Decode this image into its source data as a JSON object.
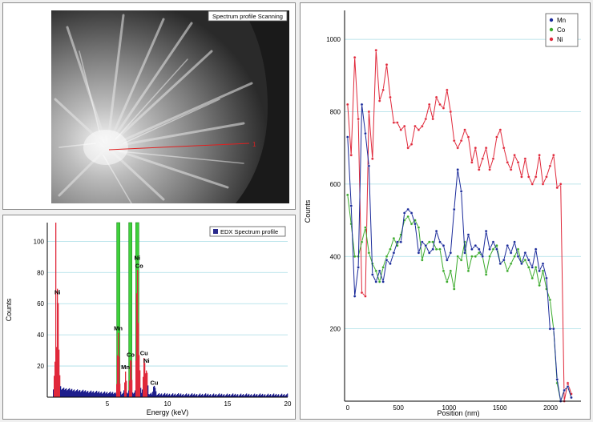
{
  "sem": {
    "legend": "Spectrum profile Scanning",
    "marker_label": "1"
  },
  "colors": {
    "axis_bg": "#ffffff",
    "grid": "#a8dde6",
    "mn": "#1a2a9a",
    "co": "#3aaa2a",
    "ni": "#e0283a",
    "edx_fill": "#1e1e8c",
    "edx_legend": "#2a2a8c"
  },
  "chart_data": [
    {
      "type": "bar",
      "title": "",
      "xlabel": "Energy (keV)",
      "ylabel": "Counts",
      "xlim": [
        0,
        20
      ],
      "ylim": [
        0,
        112
      ],
      "x_ticks": [
        5,
        10,
        15,
        20
      ],
      "y_ticks": [
        20,
        40,
        60,
        80,
        100
      ],
      "legend": {
        "position": "top-right",
        "entries": [
          "EDX Spectrum profile"
        ]
      },
      "peak_labels": [
        {
          "text": "Ni",
          "x": 0.85,
          "y": 66,
          "color": "#e0283a"
        },
        {
          "text": "Mn",
          "x": 5.9,
          "y": 43,
          "color": "#e0283a"
        },
        {
          "text": "Mn",
          "x": 6.5,
          "y": 18,
          "color": "#e0283a"
        },
        {
          "text": "Co",
          "x": 6.93,
          "y": 26,
          "color": "#e0283a"
        },
        {
          "text": "Ni",
          "x": 7.48,
          "y": 88,
          "color": "#3aaa2a"
        },
        {
          "text": "Co",
          "x": 7.65,
          "y": 83,
          "color": "#e0283a"
        },
        {
          "text": "Cu",
          "x": 8.05,
          "y": 27,
          "color": "#e0283a"
        },
        {
          "text": "Ni",
          "x": 8.26,
          "y": 22,
          "color": "#e0283a"
        },
        {
          "text": "Cu",
          "x": 8.9,
          "y": 8,
          "color": "#e0283a"
        }
      ],
      "window_bars": [
        {
          "x": 5.9,
          "width": 0.25,
          "value": 112
        },
        {
          "x": 6.9,
          "width": 0.25,
          "value": 112
        },
        {
          "x": 7.48,
          "width": 0.25,
          "value": 112
        }
      ],
      "peaks": [
        {
          "center": 0.6,
          "height": 8,
          "width": 0.1
        },
        {
          "center": 0.85,
          "height": 63,
          "width": 0.05
        },
        {
          "center": 0.7,
          "height": 102,
          "width": 0.03
        },
        {
          "center": 0.95,
          "height": 22,
          "width": 0.06
        },
        {
          "center": 5.9,
          "height": 38,
          "width": 0.07
        },
        {
          "center": 6.5,
          "height": 14,
          "width": 0.06
        },
        {
          "center": 6.93,
          "height": 24,
          "width": 0.07
        },
        {
          "center": 7.48,
          "height": 80,
          "width": 0.07
        },
        {
          "center": 7.65,
          "height": 18,
          "width": 0.07
        },
        {
          "center": 8.05,
          "height": 24,
          "width": 0.07
        },
        {
          "center": 8.26,
          "height": 16,
          "width": 0.07
        },
        {
          "center": 8.9,
          "height": 6,
          "width": 0.08
        }
      ]
    },
    {
      "type": "line",
      "title": "",
      "xlabel": "Position (nm)",
      "ylabel": "Counts",
      "xlim": [
        -30,
        2300
      ],
      "ylim": [
        0,
        1080
      ],
      "x_ticks": [
        0,
        500,
        1000,
        1500,
        2000
      ],
      "y_ticks": [
        200,
        400,
        600,
        800,
        1000
      ],
      "legend": {
        "position": "top-right"
      },
      "x": [
        0,
        35,
        70,
        105,
        140,
        175,
        210,
        245,
        280,
        315,
        350,
        385,
        420,
        455,
        490,
        525,
        560,
        595,
        630,
        665,
        700,
        735,
        770,
        805,
        840,
        875,
        910,
        945,
        980,
        1015,
        1050,
        1085,
        1120,
        1155,
        1190,
        1225,
        1260,
        1295,
        1330,
        1365,
        1400,
        1435,
        1470,
        1505,
        1540,
        1575,
        1610,
        1645,
        1680,
        1715,
        1750,
        1785,
        1820,
        1855,
        1890,
        1925,
        1960,
        1995,
        2030,
        2065,
        2100,
        2135,
        2170,
        2205
      ],
      "series": [
        {
          "name": "Mn",
          "color": "#1a2a9a",
          "values": [
            730,
            540,
            290,
            370,
            820,
            740,
            650,
            350,
            330,
            360,
            330,
            390,
            380,
            410,
            440,
            440,
            520,
            530,
            520,
            490,
            410,
            440,
            430,
            410,
            420,
            470,
            440,
            430,
            390,
            410,
            530,
            640,
            580,
            410,
            460,
            420,
            430,
            420,
            400,
            470,
            420,
            440,
            420,
            380,
            390,
            430,
            410,
            440,
            400,
            380,
            410,
            390,
            370,
            420,
            360,
            380,
            340,
            200,
            200,
            60,
            0,
            30,
            40,
            10
          ]
        },
        {
          "name": "Co",
          "color": "#3aaa2a",
          "values": [
            570,
            490,
            400,
            400,
            440,
            480,
            410,
            380,
            360,
            330,
            370,
            400,
            420,
            450,
            430,
            460,
            500,
            510,
            490,
            500,
            480,
            390,
            430,
            440,
            440,
            420,
            420,
            360,
            330,
            360,
            310,
            400,
            390,
            440,
            360,
            400,
            400,
            410,
            400,
            350,
            400,
            420,
            430,
            380,
            390,
            360,
            380,
            400,
            420,
            380,
            390,
            370,
            340,
            370,
            320,
            360,
            310,
            280,
            200,
            50,
            0,
            30,
            40,
            10
          ]
        },
        {
          "name": "Ni",
          "color": "#e0283a",
          "values": [
            820,
            680,
            950,
            780,
            300,
            290,
            800,
            670,
            970,
            830,
            860,
            930,
            840,
            770,
            770,
            750,
            760,
            700,
            710,
            760,
            750,
            760,
            780,
            820,
            780,
            840,
            820,
            810,
            860,
            800,
            720,
            700,
            720,
            750,
            730,
            660,
            700,
            640,
            670,
            700,
            640,
            670,
            730,
            750,
            700,
            660,
            640,
            680,
            660,
            620,
            670,
            620,
            600,
            620,
            680,
            600,
            620,
            650,
            680,
            590,
            600,
            0,
            50,
            20
          ]
        }
      ]
    }
  ]
}
